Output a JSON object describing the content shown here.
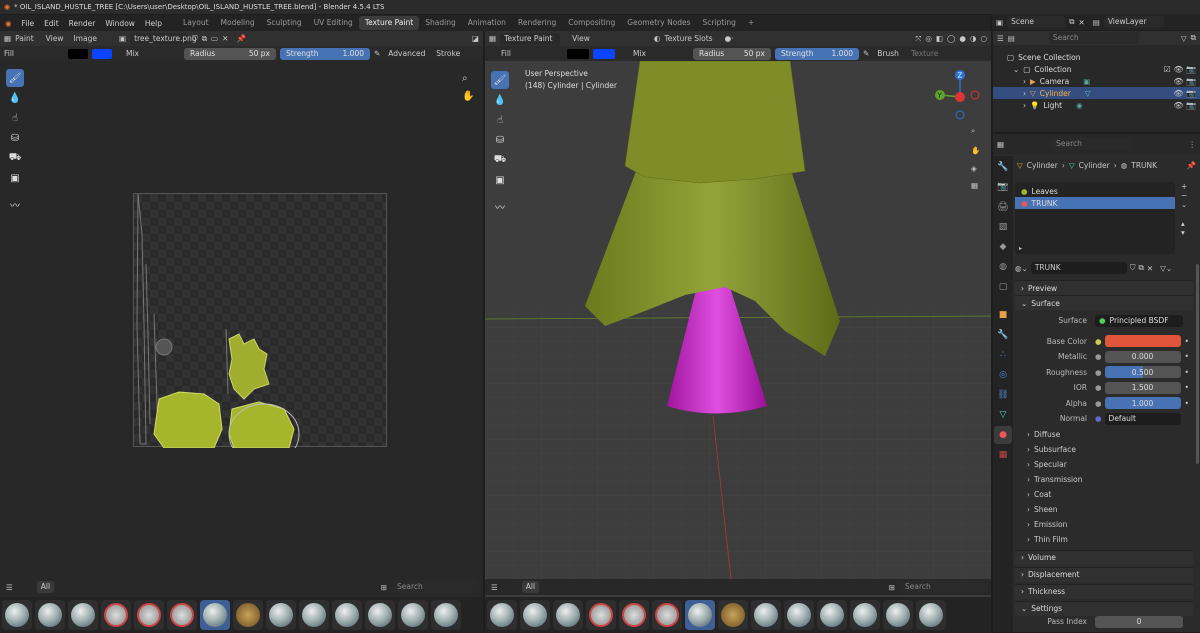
{
  "window": {
    "title": "* OIL_ISLAND_HUSTLE_TREE [C:\\Users\\user\\Desktop\\OIL_ISLAND_HUSTLE_TREE.blend] - Blender 4.5.4 LTS",
    "close": "✕",
    "min": "—",
    "max": "☐"
  },
  "menu": [
    "File",
    "Edit",
    "Render",
    "Window",
    "Help"
  ],
  "workspaces": [
    "Layout",
    "Modeling",
    "Sculpting",
    "UV Editing",
    "Texture Paint",
    "Shading",
    "Animation",
    "Rendering",
    "Compositing",
    "Geometry Nodes",
    "Scripting"
  ],
  "active_workspace": "Texture Paint",
  "scene": {
    "label": "Scene",
    "viewlayer": "ViewLayer"
  },
  "left": {
    "mode": "Paint",
    "view": "View",
    "image": "Image",
    "image_name": "tree_texture.png",
    "fill": "Fill",
    "blend": "Mix",
    "radius_label": "Radius",
    "radius_value": "50 px",
    "strength_label": "Strength",
    "strength_value": "1.000",
    "advanced": "Advanced",
    "stroke": "Stroke",
    "color_fg": "#000000",
    "color_bg": "#0a44ff"
  },
  "right": {
    "mode": "Texture Paint",
    "view": "View",
    "slots": "Texture Slots",
    "fill": "Fill",
    "blend": "Mix",
    "radius_label": "Radius",
    "radius_value": "50 px",
    "strength_label": "Strength",
    "strength_value": "1.000",
    "brush": "Brush",
    "texture": "Texture",
    "overlay1": "User Perspective",
    "overlay2": "(148) Cylinder | Cylinder"
  },
  "brush_footer": {
    "filter": "All",
    "search": "Search"
  },
  "outliner": {
    "search": "Search",
    "rows": [
      {
        "label": "Scene Collection"
      },
      {
        "label": "Collection"
      },
      {
        "label": "Camera"
      },
      {
        "label": "Cylinder"
      },
      {
        "label": "Light"
      }
    ]
  },
  "properties": {
    "search": "Search",
    "breadcrumb": [
      "Cylinder",
      "Cylinder",
      "TRUNK"
    ],
    "materials": [
      "Leaves",
      "TRUNK"
    ],
    "material_name": "TRUNK",
    "sections": {
      "preview": "Preview",
      "surface": "Surface"
    },
    "surface_label": "Surface",
    "surface_value": "Principled BSDF",
    "fields": [
      {
        "label": "Base Color",
        "value": ""
      },
      {
        "label": "Metallic",
        "value": "0.000"
      },
      {
        "label": "Roughness",
        "value": "0.500"
      },
      {
        "label": "IOR",
        "value": "1.500"
      },
      {
        "label": "Alpha",
        "value": "1.000"
      },
      {
        "label": "Normal",
        "value": "Default"
      }
    ],
    "subsections": [
      "Diffuse",
      "Subsurface",
      "Specular",
      "Transmission",
      "Coat",
      "Sheen",
      "Emission",
      "Thin Film"
    ],
    "bottom": [
      "Volume",
      "Displacement",
      "Thickness",
      "Settings"
    ],
    "pass_index": "Pass Index",
    "pass_value": "0",
    "base_color": "#e0553a"
  },
  "gizmo": {
    "z": "Z",
    "y": "Y",
    "x": "X"
  }
}
